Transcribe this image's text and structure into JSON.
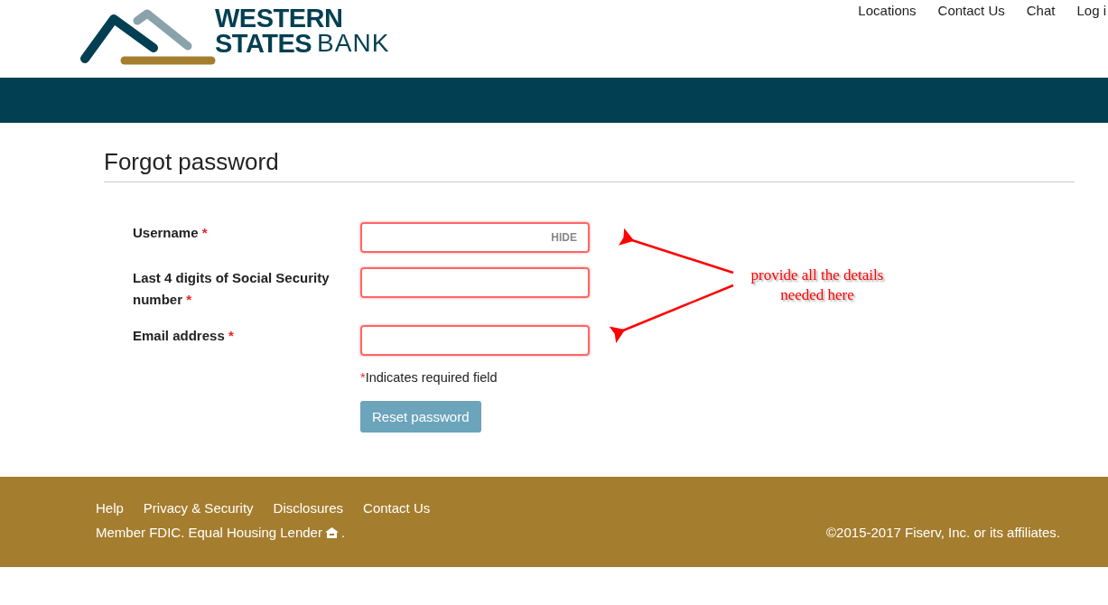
{
  "logo": {
    "line_1": "WESTERN",
    "line_2": "STATES",
    "line_3": "BANK"
  },
  "nav": [
    "Locations",
    "Contact Us",
    "Chat",
    "Log i"
  ],
  "title": "Forgot password",
  "fields": [
    {
      "label": "Username",
      "required": true,
      "toggle": "HIDE"
    },
    {
      "label": "Last 4 digits of Social Security number",
      "required": true
    },
    {
      "label": "Email address",
      "required": true
    }
  ],
  "required_mark": "*",
  "required_note": "Indicates required field",
  "submit": "Reset password",
  "annotation": "provide all the details needed here",
  "footer": {
    "links": [
      "Help",
      "Privacy & Security",
      "Disclosures",
      "Contact Us"
    ],
    "member": "Member FDIC. Equal Housing Lender",
    "member_end": ".",
    "copyright": "©2015-2017 Fiserv, Inc. or its affiliates."
  }
}
